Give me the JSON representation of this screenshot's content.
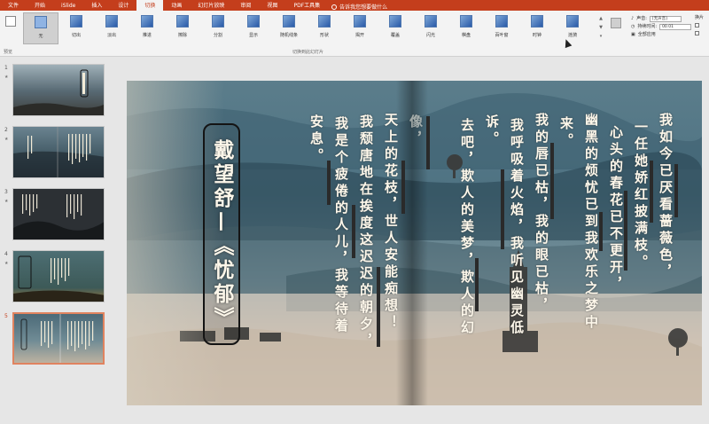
{
  "ribbon": {
    "tabs": [
      "文件",
      "开始",
      "iSlide",
      "插入",
      "设计",
      "切换",
      "动画",
      "幻灯片放映",
      "审阅",
      "视图",
      "PDF工具集"
    ],
    "active_tab": "切换",
    "tell_me": "告诉我您想要做什么",
    "preview_label": "预览",
    "group_transitions_label": "切换到此幻灯片",
    "effects": [
      "无",
      "切出",
      "淡出",
      "推进",
      "擦除",
      "分割",
      "显示",
      "随机线条",
      "形状",
      "揭开",
      "覆盖",
      "闪光",
      "棋盘",
      "百叶窗",
      "时钟",
      "涟漪"
    ],
    "selected_effect": "无",
    "effect_options_label": "效果选项",
    "timing": {
      "sound_label": "声音:",
      "sound_value": "[无声音]",
      "duration_label": "持续时间:",
      "duration_value": "00.01",
      "apply_all_label": "全部应用"
    },
    "advance_label": "换片",
    "colors": {
      "accent": "#c43e1c",
      "ribbon_bg": "#f3f3f3",
      "selection_border": "#e0835f"
    }
  },
  "slides": [
    {
      "num": "1",
      "marker": "★"
    },
    {
      "num": "2",
      "marker": "★"
    },
    {
      "num": "3",
      "marker": "★"
    },
    {
      "num": "4",
      "marker": "★"
    },
    {
      "num": "5",
      "marker": ""
    }
  ],
  "poem": {
    "title": "戴望舒—《忧郁》",
    "columns": [
      "我如今已厌看蔷薇色，",
      "一任她娇红披满枝。",
      "心头的春花已不更开，",
      "幽黑的烦忧已到我欢乐之梦中",
      "来。",
      "我的唇已枯，我的眼已枯，",
      "我呼吸着火焰，我听见幽灵低",
      "诉。",
      "去吧，欺人的美梦，欺人的幻",
      "像，",
      "天上的花枝，世人安能痴想！",
      "我颓唐地在挨度这迟迟的朝夕，",
      "我是个疲倦的人儿，我等待着",
      "安息。"
    ]
  }
}
